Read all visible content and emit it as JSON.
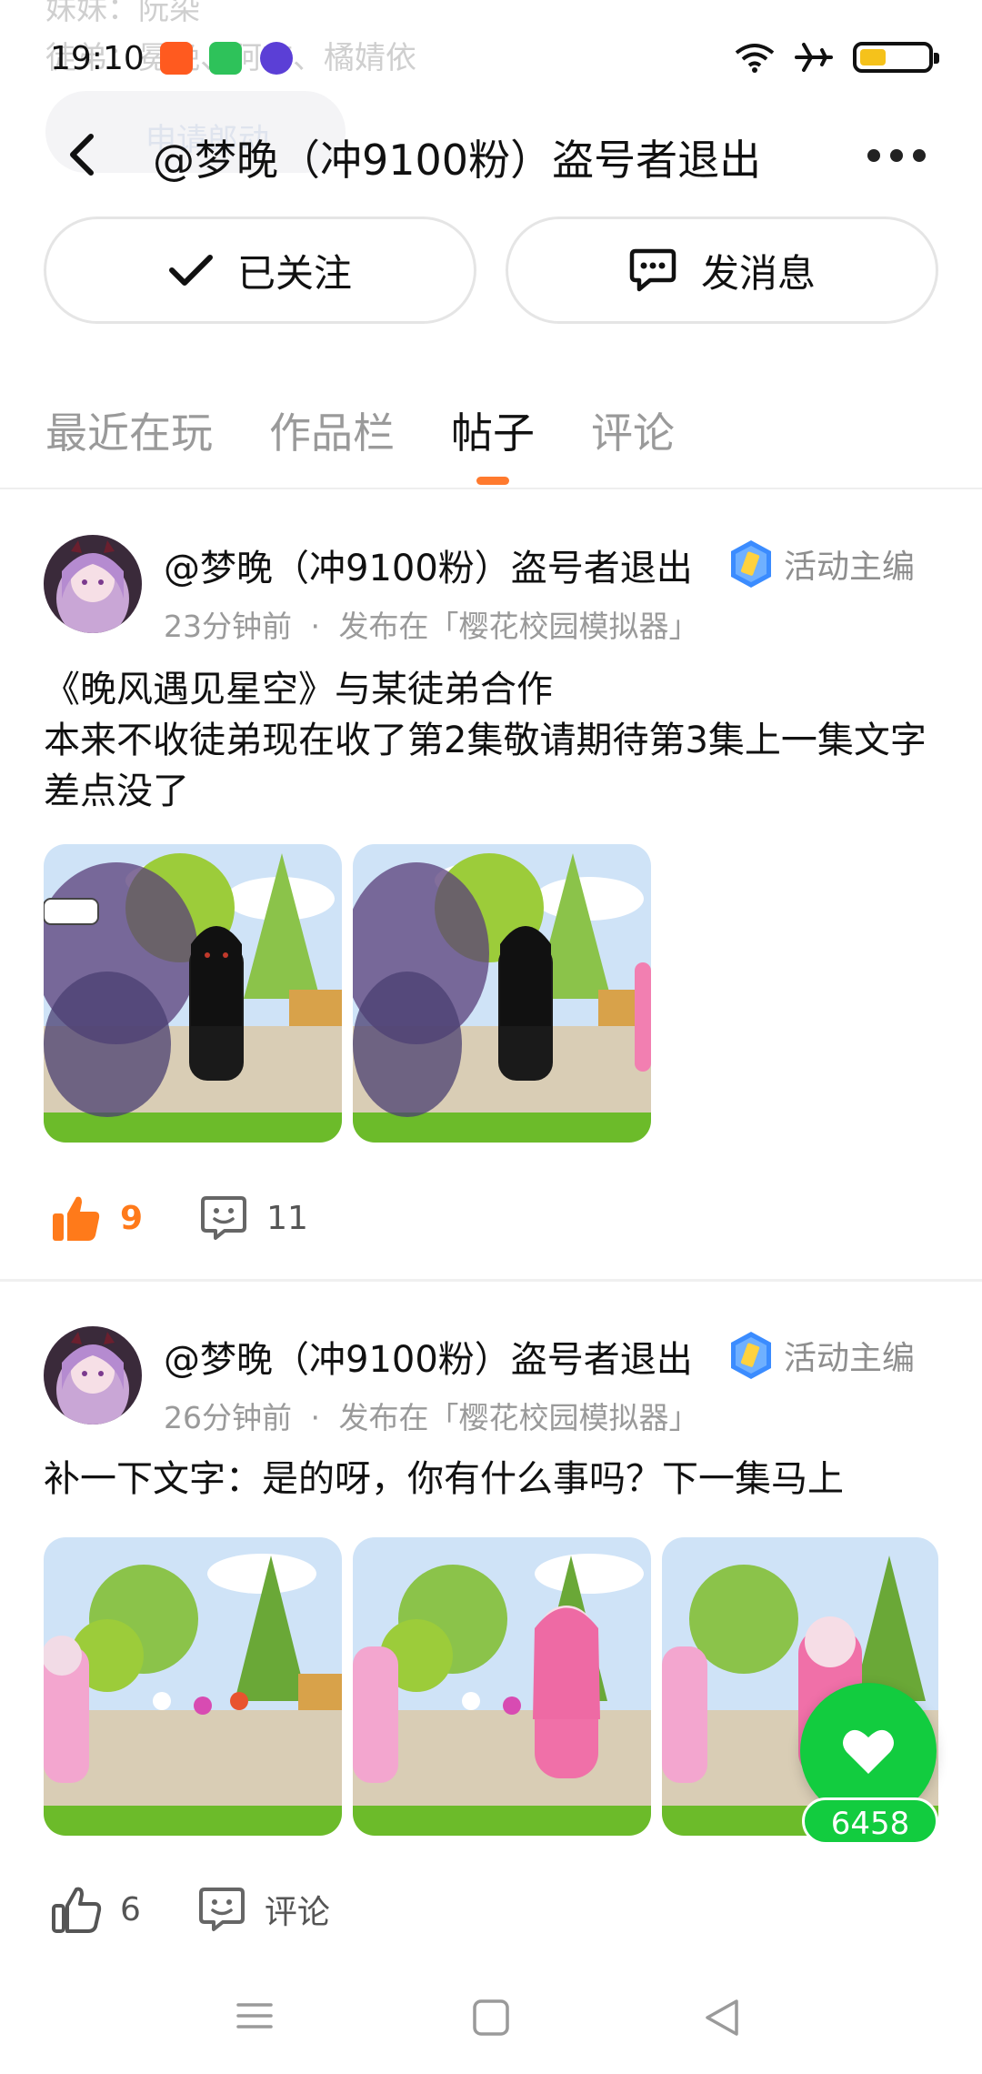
{
  "background": {
    "line1": "妹妹：阮染",
    "line2": "徒弟：冕晚、阿言、橘婧依",
    "pill_text": "申请郎动"
  },
  "status_bar": {
    "time": "19:10",
    "battery_level": 0.35,
    "icons": [
      "app-icon-orange",
      "app-icon-green",
      "app-icon-purple",
      "wifi-icon",
      "airplane-icon",
      "battery-icon"
    ]
  },
  "header": {
    "title": "@梦晚（冲9100粉）盗号者退出",
    "back_icon": "back-arrow-icon",
    "more_icon": "more-icon"
  },
  "actions": {
    "follow_label": "已关注",
    "message_label": "发消息"
  },
  "tabs": [
    {
      "label": "最近在玩"
    },
    {
      "label": "作品栏"
    },
    {
      "label": "帖子"
    },
    {
      "label": "评论"
    }
  ],
  "active_tab": "帖子",
  "accent_color": "#ff7a2e",
  "posts": [
    {
      "author": "@梦晚（冲9100粉）盗号者退出",
      "role": "活动主编",
      "time": "23分钟前",
      "dot": "·",
      "published_in": "发布在「樱花校园模拟器」",
      "line1": "《晚风遇见星空》与某徒弟合作",
      "line2": "本来不收徒弟现在收了第2集敬请期待第3集上一集文字差点没了",
      "likes": "9",
      "comments": "11",
      "liked": true
    },
    {
      "author": "@梦晚（冲9100粉）盗号者退出",
      "role": "活动主编",
      "time": "26分钟前",
      "dot": "·",
      "published_in": "发布在「樱花校园模拟器」",
      "line1": "补一下文字：是的呀，你有什么事吗？下一集马上",
      "likes": "6",
      "comments": "评论",
      "liked": false
    }
  ],
  "floating_like": {
    "count": "6458",
    "color": "#12cc3f"
  }
}
